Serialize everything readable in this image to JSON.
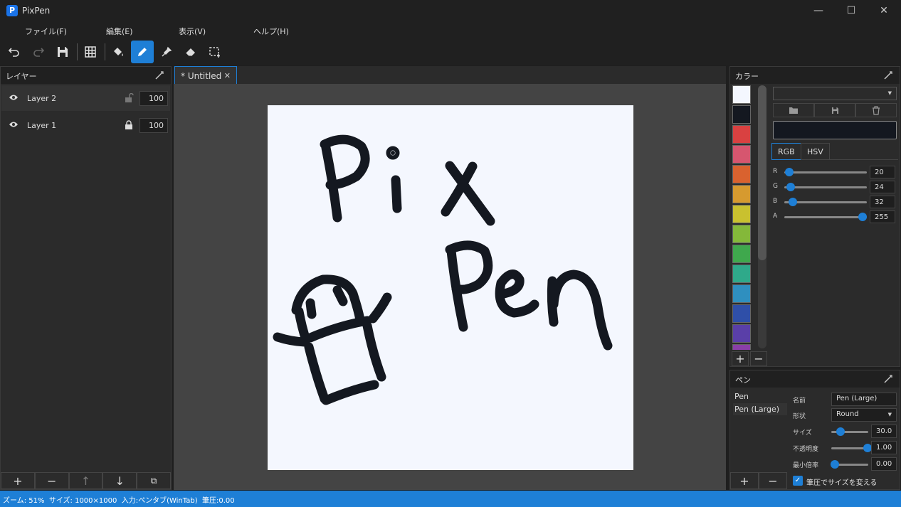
{
  "app": {
    "title": "PixPen",
    "logo_letter": "P"
  },
  "window_controls": {
    "minimize": "—",
    "maximize": "☐",
    "close": "✕"
  },
  "menu": [
    {
      "label": "ファイル(F)"
    },
    {
      "label": "編集(E)"
    },
    {
      "label": "表示(V)"
    },
    {
      "label": "ヘルプ(H)"
    }
  ],
  "toolbar": {
    "tools": [
      "undo-icon",
      "redo-icon",
      "save-icon",
      "grid-icon",
      "fill-icon",
      "pen-icon",
      "eyedropper-icon",
      "eraser-icon",
      "selection-icon"
    ],
    "active_tool": "pen-icon"
  },
  "layers": {
    "title": "レイヤー",
    "items": [
      {
        "name": "Layer 2",
        "opacity": "100",
        "locked": false,
        "visible": true
      },
      {
        "name": "Layer 1",
        "opacity": "100",
        "locked": true,
        "visible": true
      }
    ],
    "bottom_buttons": [
      "+",
      "−",
      "↑",
      "↓",
      "⧉"
    ]
  },
  "document": {
    "tab_label": "* Untitled",
    "tab_close": "✕",
    "canvas_bg": "#f4f7fe",
    "ink": "#141820"
  },
  "color_panel": {
    "title": "カラー",
    "swatches": [
      "#f4f7fe",
      "#141820",
      "#d94141",
      "#d6566f",
      "#d9622f",
      "#d69a2f",
      "#c9c12f",
      "#84b83a",
      "#3fa84d",
      "#2fa98a",
      "#2f8fbf",
      "#2f4fa8",
      "#5a3fa8",
      "#8a3fa8"
    ],
    "swatch_add": "+",
    "swatch_remove": "−",
    "palette_select_value": "",
    "current_color": "#141820",
    "tabs": [
      "RGB",
      "HSV"
    ],
    "active_tab": "RGB",
    "channels": [
      {
        "label": "R",
        "value": "20"
      },
      {
        "label": "G",
        "value": "24"
      },
      {
        "label": "B",
        "value": "32"
      },
      {
        "label": "A",
        "value": "255"
      }
    ]
  },
  "pen_panel": {
    "title": "ペン",
    "pens": [
      "Pen",
      "Pen (Large)"
    ],
    "selected_pen": "Pen (Large)",
    "props": {
      "name_label": "名前",
      "name_value": "Pen (Large)",
      "shape_label": "形状",
      "shape_value": "Round",
      "size_label": "サイズ",
      "size_value": "30.0",
      "opacity_label": "不透明度",
      "opacity_value": "1.00",
      "minscale_label": "最小倍率",
      "minscale_value": "0.00"
    },
    "add": "+",
    "remove": "−",
    "pressure_label": "筆圧でサイズを変える",
    "pressure_checked": true
  },
  "status": {
    "text": "ズーム: 51%  サイズ: 1000×1000  入力:ペンタブ(WinTab)  筆圧:0.00"
  },
  "colors": {
    "accent": "#1e7fd6"
  }
}
